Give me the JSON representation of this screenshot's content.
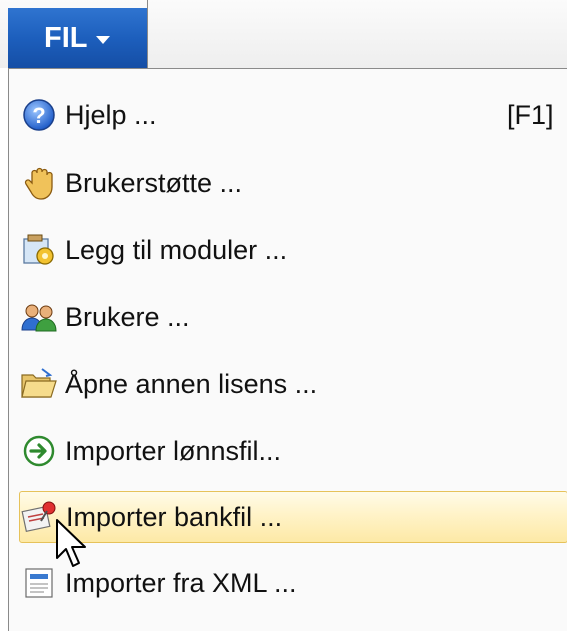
{
  "menu_button": {
    "label": "FIL"
  },
  "menu": {
    "items": [
      {
        "label": "Hjelp ...",
        "shortcut": "[F1]",
        "icon": "help-icon"
      },
      {
        "label": "Brukerstøtte ...",
        "icon": "hand-icon"
      },
      {
        "label": "Legg til moduler ...",
        "icon": "add-modules-icon"
      },
      {
        "label": "Brukere ...",
        "icon": "users-icon"
      },
      {
        "label": "Åpne annen lisens ...",
        "icon": "open-folder-icon"
      },
      {
        "label": "Importer lønnsfil...",
        "icon": "arrow-circle-icon"
      },
      {
        "label": "Importer bankfil ...",
        "icon": "bank-import-icon",
        "highlighted": true
      },
      {
        "label": "Importer fra XML ...",
        "icon": "xml-import-icon"
      }
    ]
  },
  "colors": {
    "menu_button_bg": "#1d5fbd",
    "highlight_bg": "#fff3c8",
    "highlight_border": "#e6c25a"
  }
}
